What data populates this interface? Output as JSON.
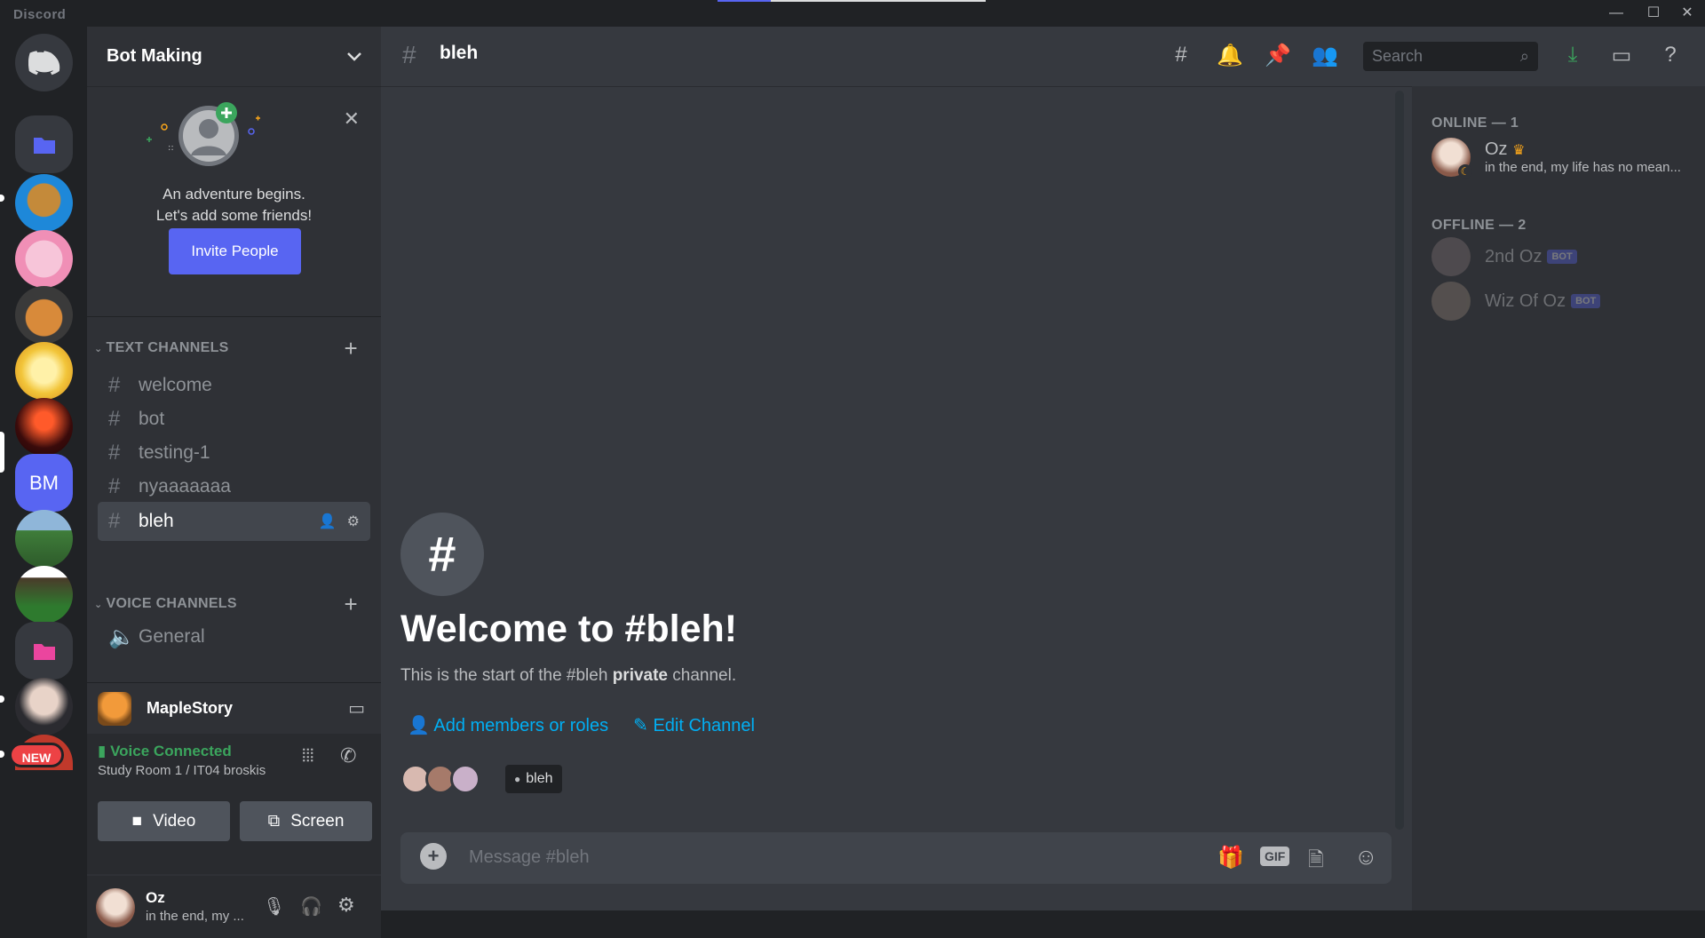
{
  "app": {
    "brand": "Discord"
  },
  "window": {
    "minimize": "—",
    "maximize": "☐",
    "close": "✕"
  },
  "rail": {
    "new_badge": "NEW",
    "bm_label": "BM"
  },
  "server": {
    "name": "Bot Making"
  },
  "invite": {
    "line1": "An adventure begins.",
    "line2": "Let's add some friends!",
    "button": "Invite People"
  },
  "categories": {
    "text": "TEXT CHANNELS",
    "voice": "VOICE CHANNELS"
  },
  "channels": [
    {
      "name": "welcome"
    },
    {
      "name": "bot"
    },
    {
      "name": "testing-1"
    },
    {
      "name": "nyaaaaaaa"
    },
    {
      "name": "bleh"
    }
  ],
  "voice_channels": [
    {
      "name": "General"
    }
  ],
  "activity": {
    "name": "MapleStory"
  },
  "voice": {
    "status": "Voice Connected",
    "room": "Study Room 1 / IT04 broskis",
    "video": "Video",
    "screen": "Screen"
  },
  "user": {
    "name": "Oz",
    "status": "in the end, my ..."
  },
  "header": {
    "channel": "bleh",
    "search_placeholder": "Search"
  },
  "welcome": {
    "title": "Welcome to #bleh!",
    "sub_prefix": "This is the start of the #bleh ",
    "sub_bold": "private",
    "sub_suffix": " channel.",
    "add_members": "Add members or roles",
    "edit_channel": "Edit Channel",
    "chip": "bleh"
  },
  "composer": {
    "placeholder": "Message #bleh",
    "gif": "GIF"
  },
  "members": {
    "online_header": "ONLINE — 1",
    "offline_header": "OFFLINE — 2",
    "online": [
      {
        "name": "Oz",
        "status": "in the end, my life has no mean..."
      }
    ],
    "offline": [
      {
        "name": "2nd Oz",
        "tag": "BOT"
      },
      {
        "name": "Wiz Of Oz",
        "tag": "BOT"
      }
    ]
  },
  "colors": {
    "accent": "#5865f2",
    "link": "#00aff4",
    "online_green": "#3ba55d",
    "bg_main": "#36393f"
  }
}
